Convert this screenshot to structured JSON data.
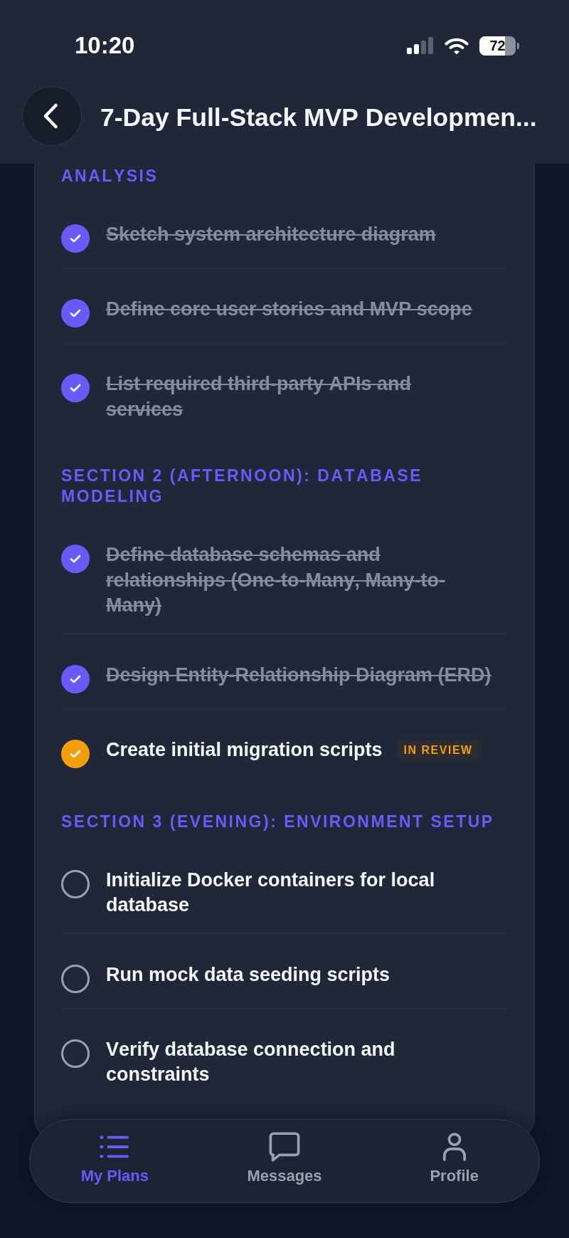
{
  "status_bar": {
    "time": "10:20",
    "battery": "72"
  },
  "header": {
    "title": "7-Day Full-Stack MVP Developmen..."
  },
  "sections": [
    {
      "heading": "ANALYSIS",
      "items": [
        {
          "text": "Sketch system architecture diagram",
          "checked": true,
          "completed": true
        },
        {
          "text": "Define core user stories and MVP scope",
          "checked": true,
          "completed": true
        },
        {
          "text": "List required third-party APIs and services",
          "checked": true,
          "completed": true
        }
      ]
    },
    {
      "heading": "SECTION 2 (AFTERNOON): DATABASE MODELING",
      "items": [
        {
          "text": "Define database schemas and relationships (One-to-Many, Many-to-Many)",
          "checked": true,
          "completed": true
        },
        {
          "text": "Design Entity-Relationship Diagram (ERD)",
          "checked": true,
          "completed": true
        },
        {
          "text": "Create initial migration scripts",
          "checked": true,
          "completed": false,
          "badge": "IN REVIEW"
        }
      ]
    },
    {
      "heading": "SECTION 3 (EVENING): ENVIRONMENT SETUP",
      "items": [
        {
          "text": "Initialize Docker containers for local database",
          "checked": false,
          "completed": false
        },
        {
          "text": "Run mock data seeding scripts",
          "checked": false,
          "completed": false
        },
        {
          "text": "Verify database connection and constraints",
          "checked": false,
          "completed": false
        }
      ]
    }
  ],
  "nav": {
    "tabs": [
      {
        "label": "My Plans",
        "selected": true
      },
      {
        "label": "Messages",
        "selected": false
      },
      {
        "label": "Profile",
        "selected": false
      }
    ]
  }
}
